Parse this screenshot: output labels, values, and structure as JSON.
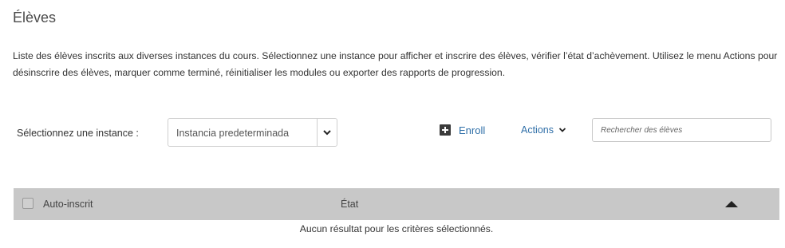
{
  "page": {
    "title": "Élèves",
    "description": "Liste des élèves inscrits aux diverses instances du cours. Sélectionnez une instance pour afficher et inscrire des élèves, vérifier l’état d’achèvement. Utilisez le menu Actions pour désinscrire des élèves, marquer comme terminé, réinitialiser les modules ou exporter des rapports de progression."
  },
  "toolbar": {
    "instance_label": "Sélectionnez une instance :",
    "instance_selected": "Instancia predeterminada",
    "enroll_label": "Enroll",
    "actions_label": "Actions",
    "search_placeholder": "Rechercher des élèves",
    "search_value": ""
  },
  "table": {
    "columns": [
      "Auto-inscrit",
      "État"
    ],
    "sort_direction": "ascending",
    "empty_message": "Aucun résultat pour les critères sélectionnés.",
    "rows": []
  },
  "icons": {
    "enroll": "plus-square-icon",
    "actions": "chevron-down-icon",
    "instance_dropdown": "chevron-down-icon",
    "sort": "triangle-up-icon"
  },
  "colors": {
    "link": "#2f6fa8",
    "header_bg": "#c8c8c8",
    "text": "#333333"
  }
}
